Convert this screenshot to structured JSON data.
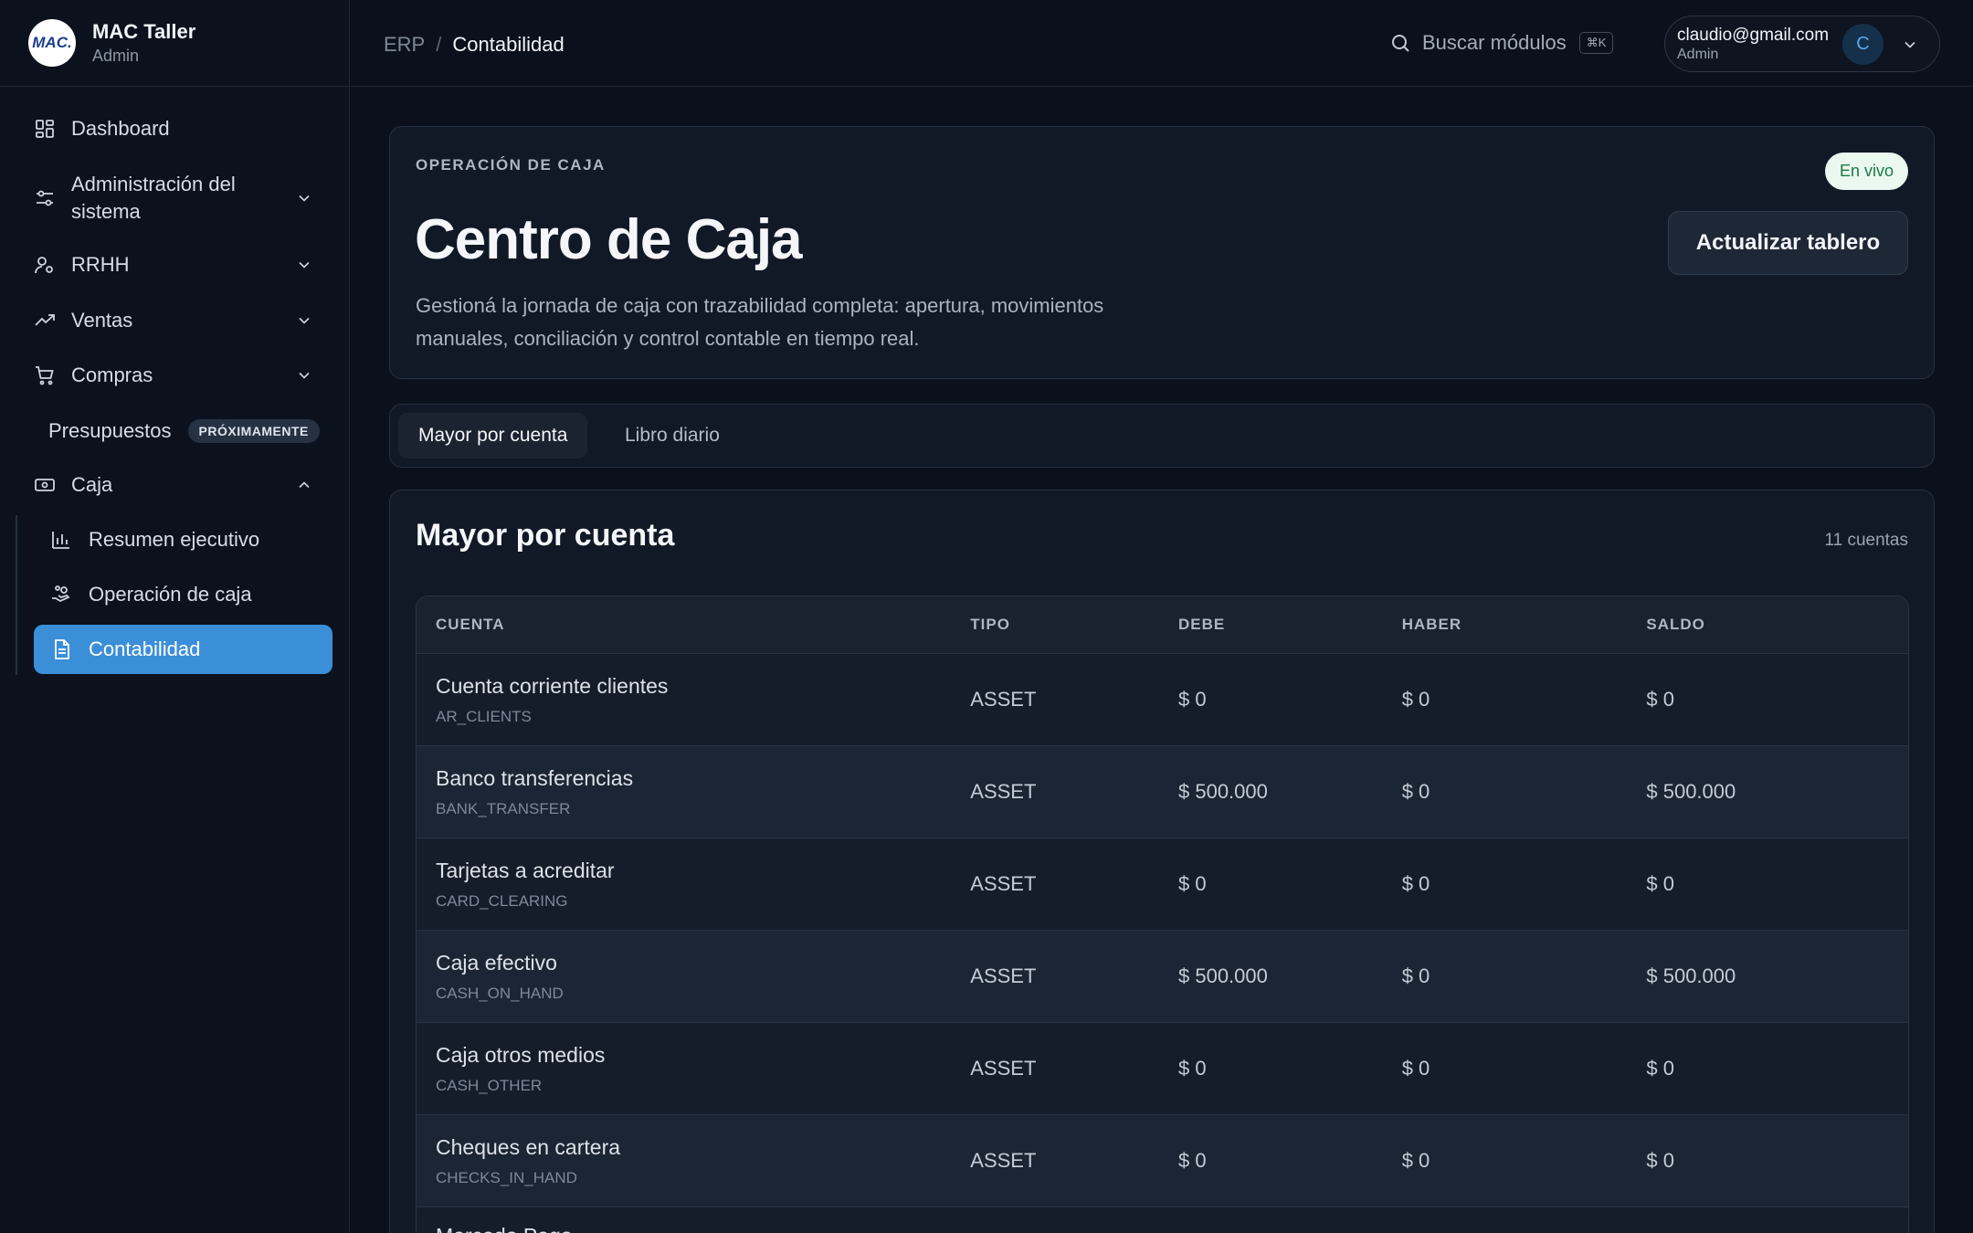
{
  "sidebar": {
    "logo_text": "MAC.",
    "brand_name": "MAC Taller",
    "brand_role": "Admin",
    "items": [
      {
        "label": "Dashboard",
        "icon": "grid-icon"
      },
      {
        "label": "Administración del sistema",
        "icon": "sliders-icon"
      },
      {
        "label": "RRHH",
        "icon": "users-icon"
      },
      {
        "label": "Ventas",
        "icon": "trend-icon"
      },
      {
        "label": "Compras",
        "icon": "cart-icon"
      },
      {
        "label": "Presupuestos",
        "badge": "PRÓXIMAMENTE"
      },
      {
        "label": "Caja",
        "icon": "cash-icon"
      }
    ],
    "caja_sub": [
      {
        "label": "Resumen ejecutivo",
        "icon": "bar-chart-icon"
      },
      {
        "label": "Operación de caja",
        "icon": "hand-coins-icon"
      },
      {
        "label": "Contabilidad",
        "icon": "document-icon"
      }
    ]
  },
  "topbar": {
    "crumb_root": "ERP",
    "crumb_sep": "/",
    "crumb_current": "Contabilidad",
    "search_label": "Buscar módulos",
    "search_kbd": "⌘K",
    "user_email": "claudio@gmail.com",
    "user_role": "Admin",
    "avatar_initial": "C"
  },
  "hero": {
    "eyebrow": "OPERACIÓN DE CAJA",
    "title": "Centro de Caja",
    "description": "Gestioná la jornada de caja con trazabilidad completa: apertura, movimientos manuales, conciliación y control contable en tiempo real.",
    "live_badge": "En vivo",
    "refresh_button": "Actualizar tablero"
  },
  "tabs": [
    {
      "label": "Mayor por cuenta",
      "active": true
    },
    {
      "label": "Libro diario",
      "active": false
    }
  ],
  "ledger": {
    "title": "Mayor por cuenta",
    "count": "11 cuentas",
    "columns": [
      "CUENTA",
      "TIPO",
      "DEBE",
      "HABER",
      "SALDO"
    ],
    "rows": [
      {
        "name": "Cuenta corriente clientes",
        "code": "AR_CLIENTS",
        "type": "ASSET",
        "debe": "$ 0",
        "haber": "$ 0",
        "saldo": "$ 0"
      },
      {
        "name": "Banco transferencias",
        "code": "BANK_TRANSFER",
        "type": "ASSET",
        "debe": "$ 500.000",
        "haber": "$ 0",
        "saldo": "$ 500.000"
      },
      {
        "name": "Tarjetas a acreditar",
        "code": "CARD_CLEARING",
        "type": "ASSET",
        "debe": "$ 0",
        "haber": "$ 0",
        "saldo": "$ 0"
      },
      {
        "name": "Caja efectivo",
        "code": "CASH_ON_HAND",
        "type": "ASSET",
        "debe": "$ 500.000",
        "haber": "$ 0",
        "saldo": "$ 500.000"
      },
      {
        "name": "Caja otros medios",
        "code": "CASH_OTHER",
        "type": "ASSET",
        "debe": "$ 0",
        "haber": "$ 0",
        "saldo": "$ 0"
      },
      {
        "name": "Cheques en cartera",
        "code": "CHECKS_IN_HAND",
        "type": "ASSET",
        "debe": "$ 0",
        "haber": "$ 0",
        "saldo": "$ 0"
      },
      {
        "name": "Mercado Pago",
        "code": "",
        "type": "",
        "debe": "",
        "haber": "",
        "saldo": ""
      }
    ]
  }
}
